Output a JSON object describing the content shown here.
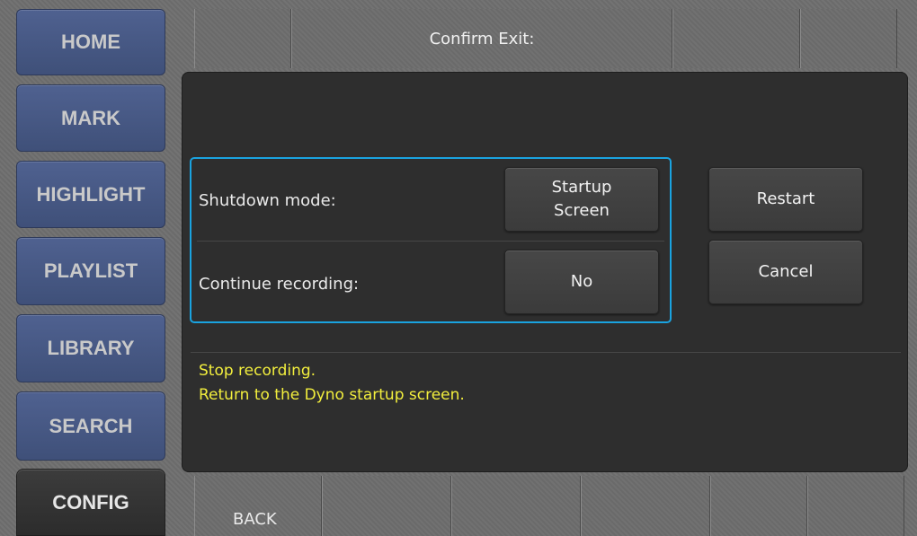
{
  "sidebar": {
    "items": [
      {
        "label": "HOME"
      },
      {
        "label": "MARK"
      },
      {
        "label": "HIGHLIGHT"
      },
      {
        "label": "PLAYLIST"
      },
      {
        "label": "LIBRARY"
      },
      {
        "label": "SEARCH"
      },
      {
        "label": "CONFIG",
        "active": true
      }
    ]
  },
  "header": {
    "title": "Confirm Exit:"
  },
  "settings": {
    "shutdown_label": "Shutdown mode:",
    "shutdown_value": "Startup Screen",
    "continue_label": "Continue recording:",
    "continue_value": "No"
  },
  "actions": {
    "restart": "Restart",
    "cancel": "Cancel"
  },
  "info": {
    "line1": "Stop recording.",
    "line2": "Return to the Dyno startup screen."
  },
  "bottom": {
    "back": "BACK"
  },
  "colors": {
    "accent_border": "#1aa3e0",
    "info_text": "#f2ee3d",
    "nav_blue": "#4f6190"
  }
}
